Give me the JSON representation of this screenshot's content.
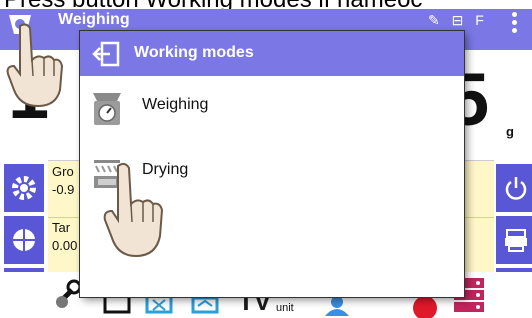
{
  "caption": "Press button Working modes if nameoc",
  "topbar": {
    "title": "Weighing",
    "status_text": "✎ ⊟ F",
    "home_icon": "scale-icon",
    "menu_icon": "kebab-menu-icon"
  },
  "display": {
    "reading": "1",
    "reading_digit": "5",
    "unit": "g"
  },
  "info": {
    "rows": [
      {
        "label": "Gro",
        "value": "-0.9"
      },
      {
        "label": "Tar",
        "value": "0.00"
      }
    ]
  },
  "side_keys": {
    "left": [
      "gear-icon",
      "pie-icon",
      "tare-icon"
    ],
    "right": [
      "power-icon",
      "printer-icon",
      "zero-icon"
    ]
  },
  "bottom_bar": {
    "icons": [
      "wrench-icon",
      "monitor-icon",
      "box-icon",
      "scale-icon",
      "text-icon",
      "unit-icon",
      "user-icon",
      "record-icon",
      "database-icon"
    ],
    "unit_label": "unit"
  },
  "modal": {
    "title": "Working modes",
    "back_icon": "exit-icon",
    "items": [
      {
        "label": "Weighing",
        "icon": "scale-icon"
      },
      {
        "label": "Drying",
        "icon": "drying-icon"
      }
    ]
  },
  "colors": {
    "header": "#7b78e6",
    "side_keys": "#5a57d6",
    "info_panel": "#fff7c8"
  }
}
